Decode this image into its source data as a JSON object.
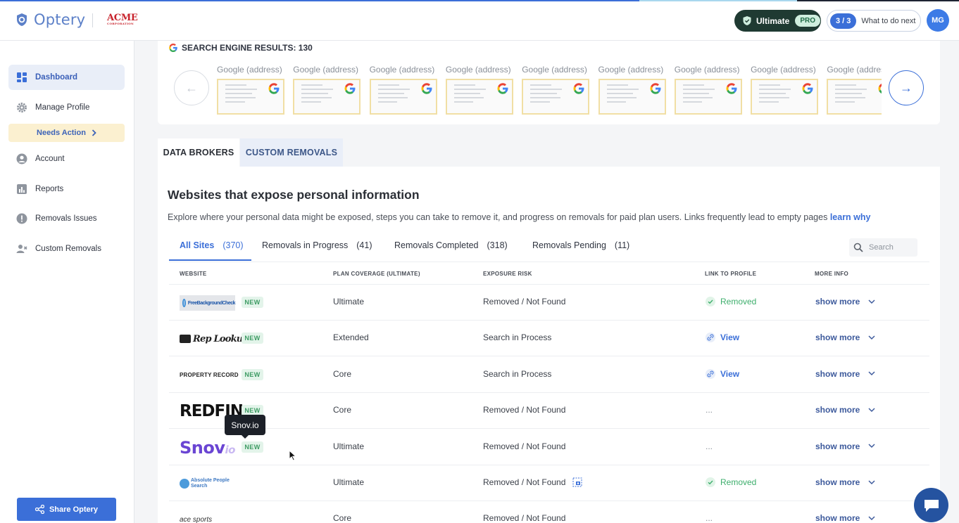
{
  "header": {
    "brand": "Optery",
    "partner_logo": "ACME",
    "partner_logo_sub": "CORPORATION",
    "plan": {
      "label": "Ultimate",
      "badge": "PRO"
    },
    "next_steps": {
      "progress": "3 / 3",
      "label": "What to do next"
    },
    "avatar_initials": "MG",
    "accent_color": "#3b6fd8"
  },
  "sidebar": {
    "items": [
      {
        "label": "Dashboard",
        "icon": "dashboard-icon",
        "active": true
      },
      {
        "label": "Manage Profile",
        "icon": "gear-icon"
      },
      {
        "label": "Account",
        "icon": "user-circle-icon"
      },
      {
        "label": "Reports",
        "icon": "chart-icon"
      },
      {
        "label": "Removals Issues",
        "icon": "alert-icon"
      },
      {
        "label": "Custom Removals",
        "icon": "user-x-icon"
      }
    ],
    "needs_action": "Needs Action",
    "share_button": "Share Optery"
  },
  "serp": {
    "title": "SEARCH ENGINE RESULTS: 130",
    "items": [
      "Google (address)",
      "Google (address)",
      "Google (address)",
      "Google (address)",
      "Google (address)",
      "Google (address)",
      "Google (address)",
      "Google (address)",
      "Google (address)"
    ]
  },
  "tabs": [
    {
      "label": "DATA BROKERS",
      "active": true
    },
    {
      "label": "CUSTOM REMOVALS",
      "active": false
    }
  ],
  "main": {
    "title": "Websites that expose personal information",
    "description": "Explore where your personal data might be exposed, steps you can take to remove it, and progress on removals for paid plan users. Links frequently lead to empty pages ",
    "learn_link": "learn why",
    "filters": [
      {
        "label": "All Sites",
        "count": "(370)",
        "active": true
      },
      {
        "label": "Removals in Progress",
        "count": "(41)"
      },
      {
        "label": "Removals Completed",
        "count": "(318)"
      },
      {
        "label": "Removals Pending",
        "count": "(11)"
      }
    ],
    "search_placeholder": "Search",
    "columns": [
      "WEBSITE",
      "PLAN COVERAGE (ULTIMATE)",
      "EXPOSURE RISK",
      "LINK TO PROFILE",
      "MORE INFO"
    ],
    "rows": [
      {
        "site": "FreeBackgroundCheck",
        "new": "NEW",
        "coverage": "Ultimate",
        "risk": "Removed / Not Found",
        "link": "Removed",
        "link_type": "removed",
        "more": "show more"
      },
      {
        "site": "Rep Lookup",
        "new": "NEW",
        "coverage": "Extended",
        "risk": "Search in Process",
        "link": "View",
        "link_type": "view",
        "more": "show more"
      },
      {
        "site": "PROPERTY RECORD",
        "new": "NEW",
        "coverage": "Core",
        "risk": "Search in Process",
        "link": "View",
        "link_type": "view",
        "more": "show more"
      },
      {
        "site": "REDFIN",
        "new": "NEW",
        "coverage": "Core",
        "risk": "Removed / Not Found",
        "link": "...",
        "link_type": "none",
        "more": "show more"
      },
      {
        "site": "Snov.io",
        "new": "NEW",
        "coverage": "Ultimate",
        "risk": "Removed / Not Found",
        "link": "...",
        "link_type": "none",
        "more": "show more"
      },
      {
        "site": "Absolute People Search",
        "new": "",
        "coverage": "Ultimate",
        "risk": "Removed / Not Found",
        "link": "Removed",
        "link_type": "removed",
        "more": "show more"
      },
      {
        "site": "ace sports",
        "new": "",
        "coverage": "Core",
        "risk": "Removed / Not Found",
        "link": "...",
        "link_type": "none",
        "more": "show more"
      }
    ],
    "tooltip": "Snov.io"
  }
}
